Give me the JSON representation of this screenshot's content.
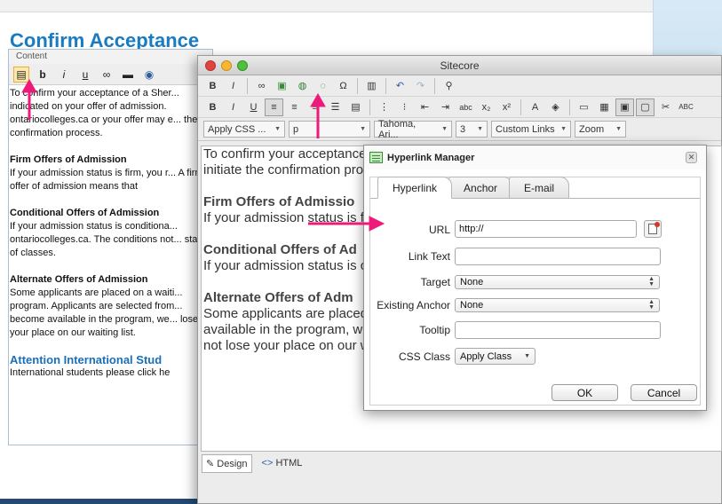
{
  "page": {
    "title": "Confirm Acceptance"
  },
  "left_editor": {
    "header": "Content",
    "toolbar": [
      {
        "name": "document-icon",
        "glyph": "▤"
      },
      {
        "name": "bold-button",
        "glyph": "b"
      },
      {
        "name": "italic-button",
        "glyph": "i"
      },
      {
        "name": "underline-button",
        "glyph": "u"
      },
      {
        "name": "link-icon",
        "glyph": "∞"
      },
      {
        "name": "image-icon",
        "glyph": "▬"
      },
      {
        "name": "compass-icon",
        "glyph": "◉"
      }
    ],
    "paragraphs": {
      "p1": "To confirm your acceptance of a Sher... indicated on your offer of admission. ontariocolleges.ca or your offer may e... the confirmation process.",
      "h_firm": "Firm Offers of Admission",
      "p_firm": "If your admission status is firm, you r... A firm offer of admission means that",
      "h_cond": "Conditional Offers of Admission",
      "p_cond": "If your admission status is conditiona... ontariocolleges.ca. The conditions not... start of classes.",
      "h_alt": "Alternate Offers of Admission",
      "p_alt": "Some applicants are placed on a waiti... program. Applicants are selected from... become available in the program, we... lose your place on our waiting list.",
      "h_intl": "Attention International Stud",
      "p_intl": "International students please click he"
    }
  },
  "sitecore": {
    "title": "Sitecore",
    "selects": {
      "apply_css": "Apply CSS ...",
      "paragraph": "p",
      "font": "Tahoma, Ari...",
      "size": "3",
      "custom_links": "Custom Links",
      "zoom": "Zoom"
    },
    "content": {
      "p1": "To confirm your acceptance date indicated on your offer ontariocolleges.ca or your o initiate the confirmation proc",
      "h_firm": "Firm Offers of Admissio",
      "p_firm": "If your admission status is f ontariocolleges.ca. A firm o",
      "h_cond": "Conditional Offers of Ad",
      "p_cond": "If your admission status is c ontariocolleges.ca. The con the start of classes.",
      "h_alt": "Alternate Offers of Adm",
      "p_alt": "Some applicants are placed alternate program. Applican Should space become available in the program, we will contact you. If you choose to ac admission, you will not lose your place on our waiting list."
    },
    "bottom_tabs": {
      "design": "Design",
      "html": "HTML"
    }
  },
  "dialog": {
    "title": "Hyperlink Manager",
    "tabs": {
      "hyperlink": "Hyperlink",
      "anchor": "Anchor",
      "email": "E-mail"
    },
    "fields": {
      "url_label": "URL",
      "url_value": "http://",
      "linktext_label": "Link Text",
      "linktext_value": "",
      "target_label": "Target",
      "target_value": "None",
      "anchor_label": "Existing Anchor",
      "anchor_value": "None",
      "tooltip_label": "Tooltip",
      "tooltip_value": "",
      "cssclass_label": "CSS Class",
      "cssclass_value": "Apply Class"
    },
    "buttons": {
      "ok": "OK",
      "cancel": "Cancel"
    }
  },
  "annotations": {
    "arrow_color": "#ee1a7a"
  }
}
